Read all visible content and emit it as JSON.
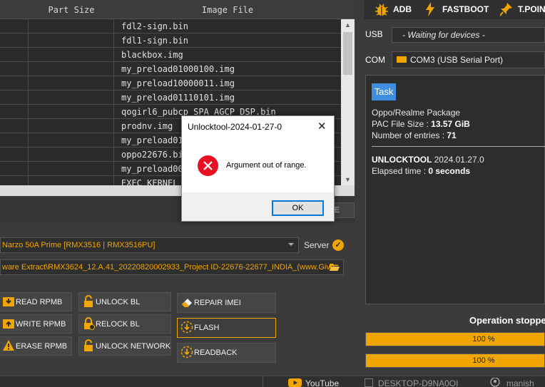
{
  "table": {
    "headers": [
      "Part Size",
      "Image File"
    ],
    "rows": [
      "fdl2-sign.bin",
      "fdl1-sign.bin",
      "blackbox.img",
      "my_preload01000100.img",
      "my_preload10000011.img",
      "my_preload01110101.img",
      "qogirl6_pubcp_SPA_AGCP_DSP.bin",
      "prodnv.img",
      "my_preload01",
      "oppo22676.bi",
      "my_preload00",
      "EXEC_KERNEL_"
    ]
  },
  "left_panel": {
    "partial_button": "CE",
    "model_value": "Narzo 50A Prime [RMX3516 | RMX3516PU]",
    "server_label": "Server",
    "firmware_path": "ware Extract\\RMX3624_12.A.41_20220820002933_Project ID-22676-22677_INDIA_(www.Give",
    "buttons": {
      "read_rpmb": "READ RPMB",
      "write_rpmb": "WRITE RPMB",
      "erase_rpmb": "ERASE RPMB",
      "unlock_bl": "UNLOCK BL",
      "relock_bl": "RELOCK BL",
      "unlock_network": "UNLOCK NETWORK",
      "repair_imei": "REPAIR IMEI",
      "flash": "FLASH",
      "readback": "READBACK"
    }
  },
  "right_panel": {
    "tabs": [
      "ADB",
      "FASTBOOT",
      "T.POIN"
    ],
    "usb_label": "USB",
    "usb_value": "- Waiting for devices -",
    "com_label": "COM",
    "com_value": "COM3 (USB Serial Port)",
    "task_label": "Task",
    "log": {
      "package": "Oppo/Realme Package",
      "pac_size_label": "PAC File Size : ",
      "pac_size_value": "13.57 GiB",
      "entries_label": "Number of entries : ",
      "entries_value": "71",
      "tool_label": "UNLOCKTOOL ",
      "tool_version": "2024.01.27.0",
      "elapsed_label": "Elapsed time : ",
      "elapsed_value": "0 seconds"
    },
    "operation_status": "Operation stoppe",
    "progress": [
      {
        "text": "100 %",
        "fraction": 1.0
      },
      {
        "text": "100 %",
        "fraction": 1.0
      }
    ]
  },
  "statusbar": {
    "youtube": "YouTube",
    "desktop": "DESKTOP-D9NA0OI",
    "user": "manish"
  },
  "dialog": {
    "title": "Unlocktool-2024-01-27-0",
    "message": "Argument out of range.",
    "ok_label": "OK"
  },
  "colors": {
    "accent": "#f0a500",
    "task_badge": "#3f8fe0",
    "error": "#e81123"
  }
}
